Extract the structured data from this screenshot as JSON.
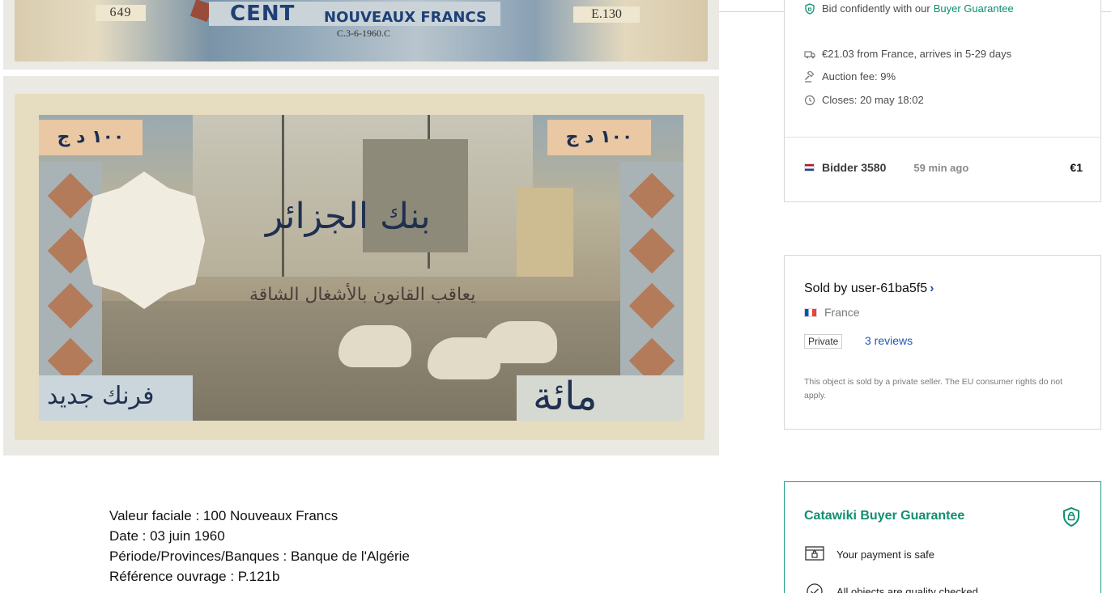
{
  "banknote": {
    "serial_left": "649",
    "serial_right": "E.130",
    "denomination_title": "CENT",
    "denomination_unit": "NOUVEAUX FRANCS",
    "print_date": "C.3-6-1960.C",
    "value_left": "١٠٠ د ج",
    "value_right": "١٠٠ د ج",
    "arabic_bank": "بنك الجزائر",
    "arabic_warning": "يعاقب القانون بالأشغال الشاقة",
    "arabic_new_franc": "فرنك جديد",
    "arabic_hundred": "مائة"
  },
  "description": {
    "lines": [
      "Valeur faciale : 100 Nouveaux Francs",
      "Date : 03 juin 1960",
      "Période/Provinces/Banques : Banque de l'Algérie",
      "Référence ouvrage : P.121b"
    ]
  },
  "bid_card": {
    "guarantee_text": "Bid confidently with our",
    "guarantee_link": "Buyer Guarantee",
    "shipping": "€21.03 from France, arrives in 5-29 days",
    "auction_fee": "Auction fee: 9%",
    "closes": "Closes: 20 may 18:02",
    "bidder": {
      "name": "Bidder 3580",
      "time": "59 min ago",
      "amount": "€1"
    }
  },
  "seller_card": {
    "title": "Sold by user-61ba5f5",
    "chevron": "›",
    "country": "France",
    "badge": "Private",
    "reviews": "3 reviews",
    "note": "This object is sold by a private seller. The EU consumer rights do not apply."
  },
  "guarantee_card": {
    "title": "Catawiki Buyer Guarantee",
    "items": [
      "Your payment is safe",
      "All objects are quality checked"
    ]
  },
  "colors": {
    "accent_green": "#0f8f72",
    "link_blue": "#1f58b8",
    "border": "#d7d7d7"
  },
  "icons": [
    "shield-icon",
    "truck-icon",
    "gavel-icon",
    "clock-icon",
    "flag-nl-icon",
    "flag-fr-icon",
    "payment-icon",
    "check-circle-icon"
  ]
}
